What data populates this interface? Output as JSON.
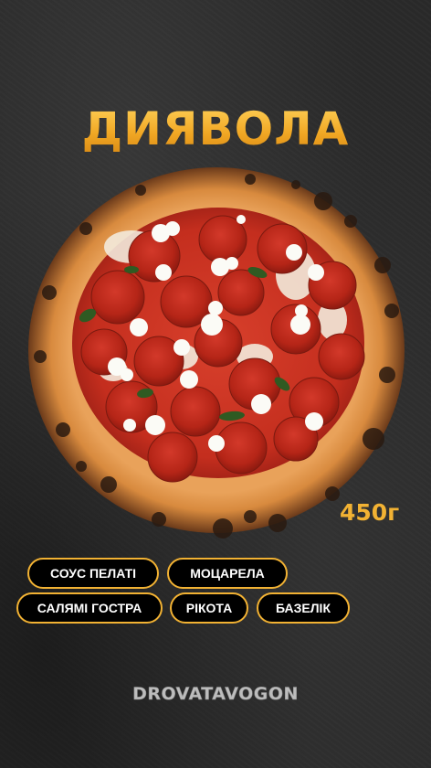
{
  "title": "ДИЯВОЛА",
  "weight": "450г",
  "ingredients": [
    "СОУС ПЕЛАТІ",
    "МОЦАРЕЛА",
    "САЛЯМІ ГОСТРА",
    "РІКОТА",
    "БАЗЕЛІК"
  ],
  "brand": "DROVATAVOGON",
  "colors": {
    "accent": "#f2b233",
    "background": "#2a2a2a",
    "chip_bg": "#000000",
    "chip_text": "#ffffff"
  }
}
